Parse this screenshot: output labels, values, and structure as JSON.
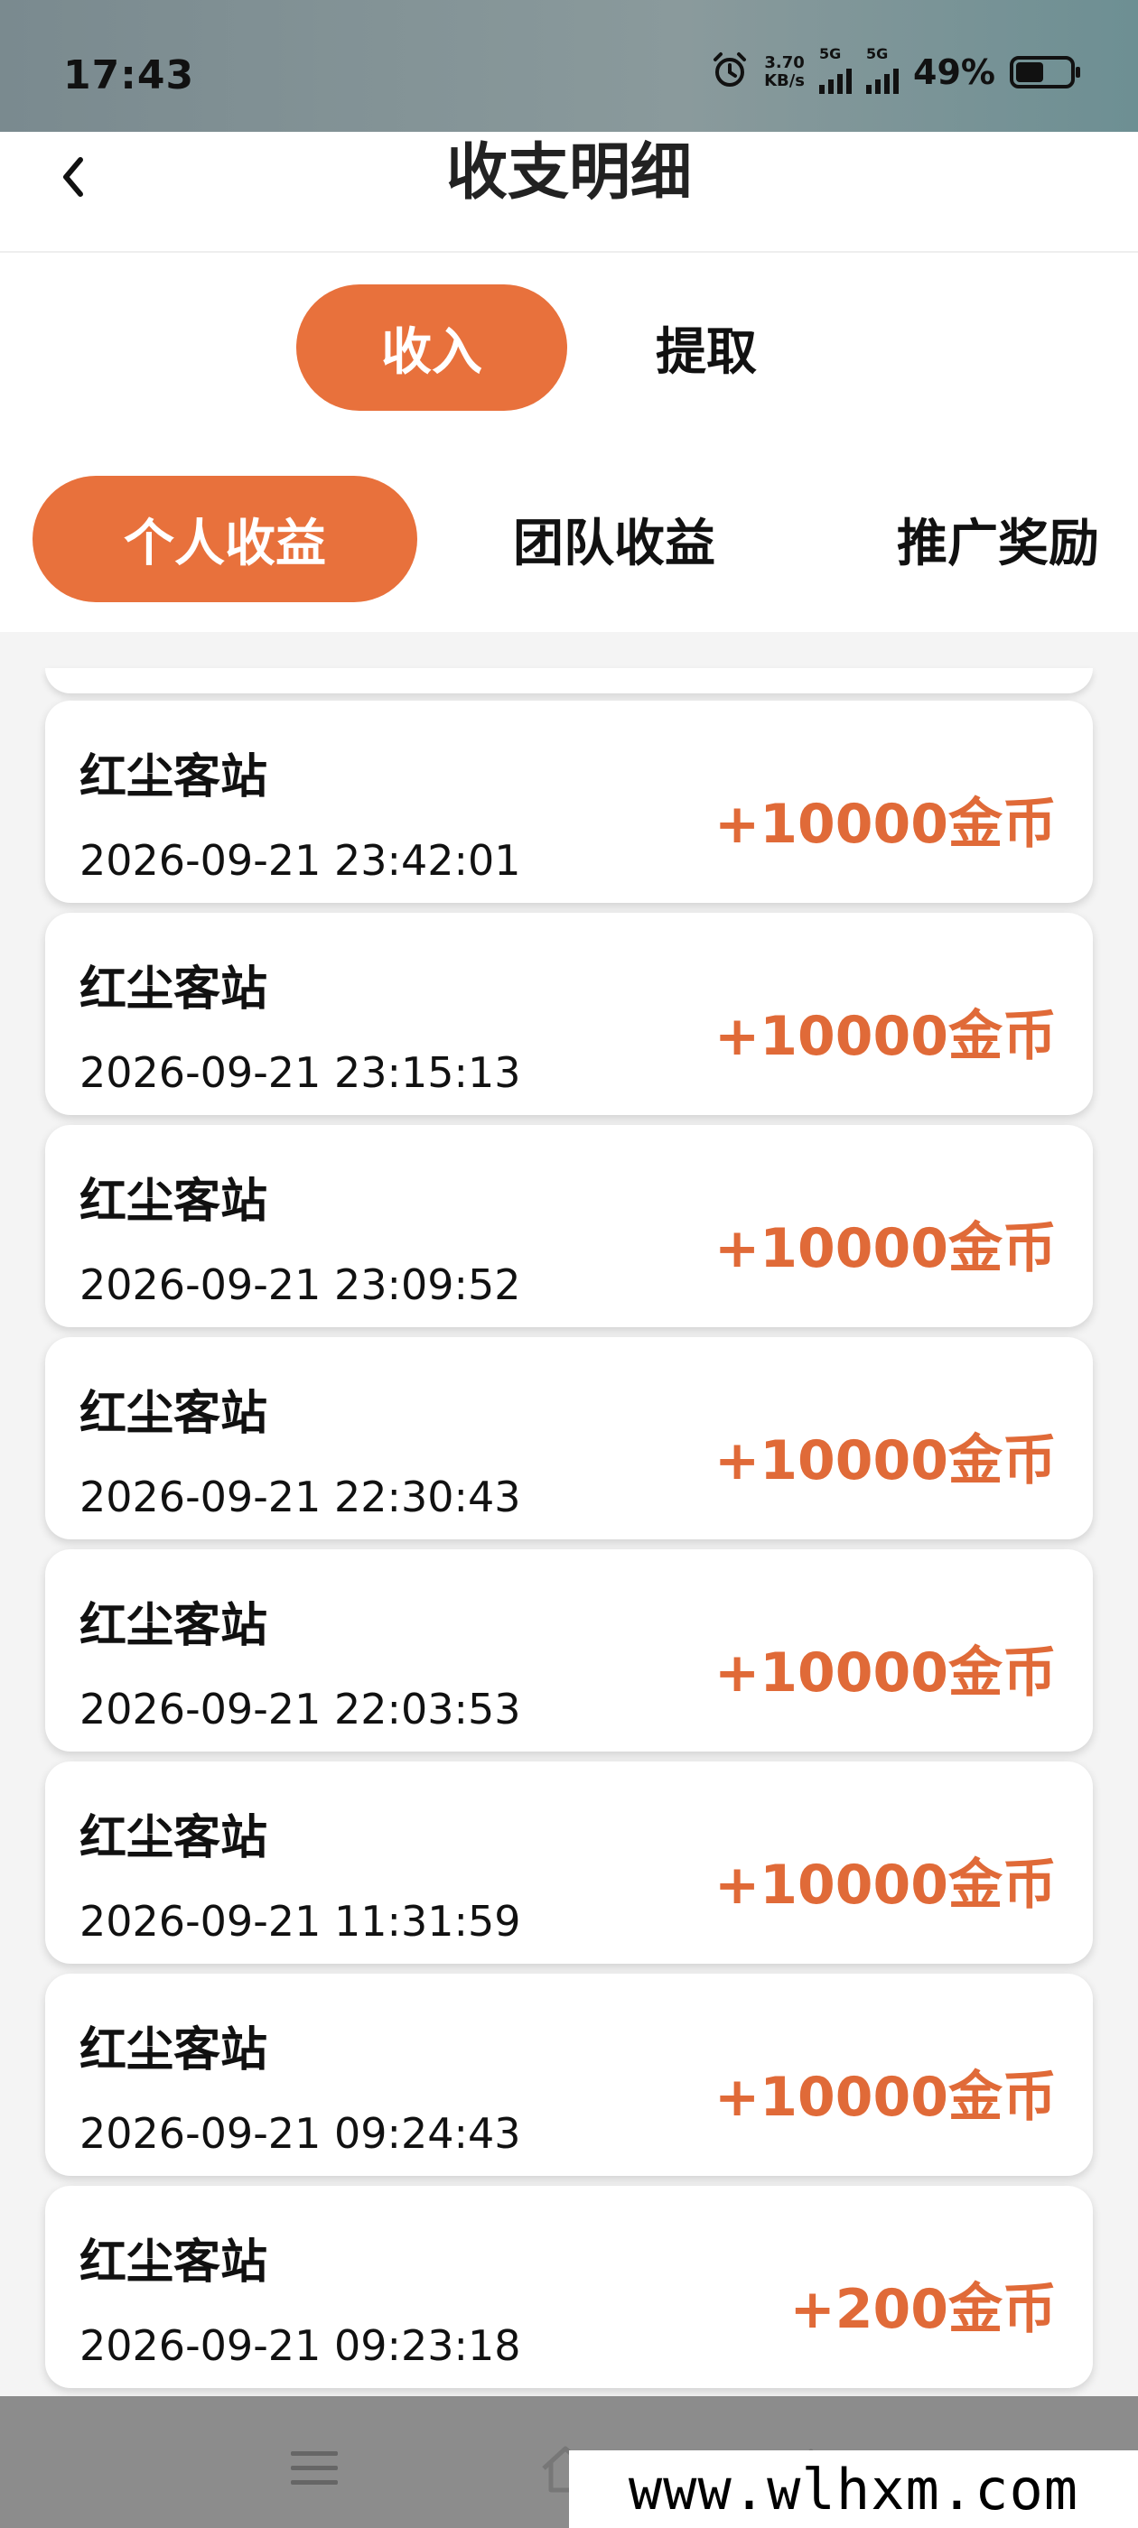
{
  "status_bar": {
    "time": "17:43",
    "alarm_icon": "alarm-clock-icon",
    "net_speed_value": "3.70",
    "net_speed_unit": "KB/s",
    "signal1_label": "5G",
    "signal2_label": "5G",
    "battery_percent": "49%"
  },
  "header": {
    "back_icon": "chevron-left-icon",
    "title": "收支明细"
  },
  "primary_tabs": [
    {
      "label": "收入",
      "active": true
    },
    {
      "label": "提取",
      "active": false
    }
  ],
  "secondary_tabs": [
    {
      "label": "个人收益",
      "active": true
    },
    {
      "label": "团队收益",
      "active": false
    },
    {
      "label": "推广奖励",
      "active": false
    }
  ],
  "records": [
    {
      "name": "红尘客站",
      "datetime": "2026-09-21 23:42:01",
      "amount": "+10000金币"
    },
    {
      "name": "红尘客站",
      "datetime": "2026-09-21 23:15:13",
      "amount": "+10000金币"
    },
    {
      "name": "红尘客站",
      "datetime": "2026-09-21 23:09:52",
      "amount": "+10000金币"
    },
    {
      "name": "红尘客站",
      "datetime": "2026-09-21 22:30:43",
      "amount": "+10000金币"
    },
    {
      "name": "红尘客站",
      "datetime": "2026-09-21 22:03:53",
      "amount": "+10000金币"
    },
    {
      "name": "红尘客站",
      "datetime": "2026-09-21 11:31:59",
      "amount": "+10000金币"
    },
    {
      "name": "红尘客站",
      "datetime": "2026-09-21 09:24:43",
      "amount": "+10000金币"
    },
    {
      "name": "红尘客站",
      "datetime": "2026-09-21 09:23:18",
      "amount": "+200金币"
    }
  ],
  "nav_bar": {
    "menu_icon": "menu-icon",
    "home_icon": "home-icon",
    "back_icon": "back-arrow-icon"
  },
  "watermark": "www.wlhxm.com",
  "colors": {
    "accent": "#e8713c",
    "amount": "#e06a38"
  }
}
